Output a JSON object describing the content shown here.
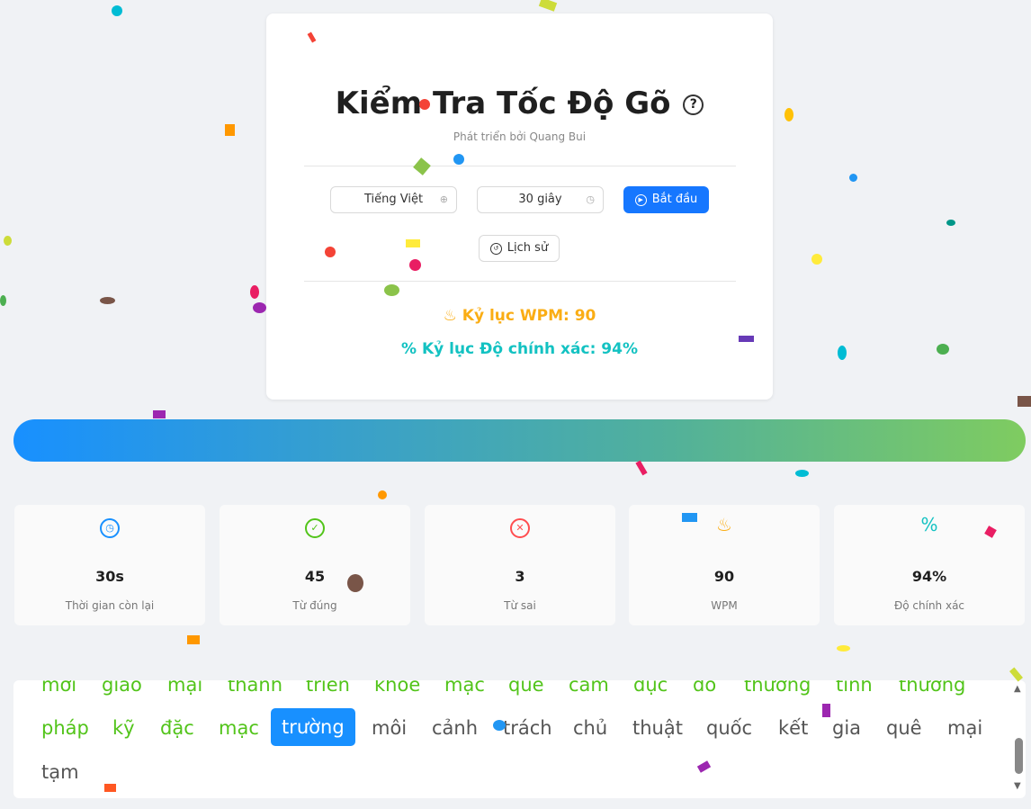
{
  "header": {
    "title": "Kiểm Tra Tốc Độ Gõ",
    "help_icon": "?",
    "subtitle": "Phát triển bởi Quang Bui"
  },
  "controls": {
    "language_value": "Tiếng Việt",
    "language_icon": "globe-icon",
    "duration_value": "30 giây",
    "duration_icon": "clock-icon",
    "start_label": "Bắt đầu",
    "history_label": "Lịch sử"
  },
  "records": {
    "wpm_label": "Kỷ lục WPM: 90",
    "wpm_icon": "fire-icon",
    "accuracy_label": "Kỷ lục Độ chính xác: 94%",
    "accuracy_icon": "percent-icon"
  },
  "progress": {
    "fraction": 1.0
  },
  "stats": [
    {
      "value": "30s",
      "label": "Thời gian còn lại",
      "icon": "clock-icon",
      "color": "#1890ff"
    },
    {
      "value": "45",
      "label": "Từ đúng",
      "icon": "check-circle-icon",
      "color": "#52c41a"
    },
    {
      "value": "3",
      "label": "Từ sai",
      "icon": "close-circle-icon",
      "color": "#ff4d4f"
    },
    {
      "value": "90",
      "label": "WPM",
      "icon": "fire-icon",
      "color": "#faad14"
    },
    {
      "value": "94%",
      "label": "Độ chính xác",
      "icon": "percent-icon",
      "color": "#13c2c2"
    }
  ],
  "words": {
    "row1": [
      "mới",
      "giao",
      "mại",
      "thành",
      "triển",
      "khỏe",
      "mạc",
      "quê",
      "cảm",
      "dục",
      "đó",
      "thường",
      "tình",
      "thương"
    ],
    "row2": [
      "pháp",
      "kỹ",
      "đặc",
      "mạc",
      "trường",
      "môi",
      "cảnh",
      "trách",
      "chủ",
      "thuật",
      "quốc",
      "kết",
      "gia",
      "quê",
      "mại"
    ],
    "row3": [
      "tạm"
    ],
    "current_index": 4
  },
  "colors": {
    "primary": "#1677ff",
    "correct": "#52c41a",
    "record_wpm": "#faad14",
    "record_accuracy": "#13c2c2"
  }
}
